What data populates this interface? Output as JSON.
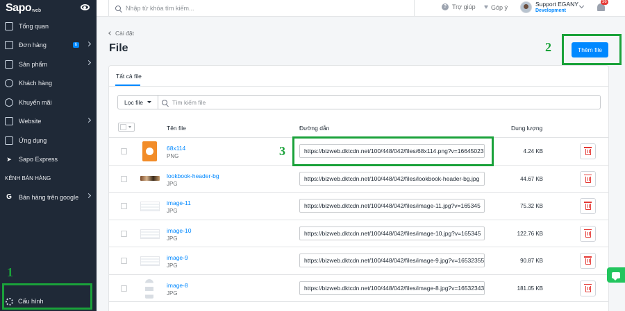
{
  "brand": {
    "name": "Sapo",
    "suffix": "web"
  },
  "sidebar": {
    "items": [
      {
        "label": "Tổng quan"
      },
      {
        "label": "Đơn hàng",
        "badge": "6"
      },
      {
        "label": "Sản phẩm"
      },
      {
        "label": "Khách hàng"
      },
      {
        "label": "Khuyến mãi"
      },
      {
        "label": "Website"
      },
      {
        "label": "Ứng dụng"
      },
      {
        "label": "Sapo Express"
      }
    ],
    "section_label": "KÊNH BÁN HÀNG",
    "channel_item": {
      "label": "Bán hàng trên google"
    },
    "settings_label": "Cấu hình"
  },
  "topbar": {
    "search_placeholder": "Nhập từ khóa tìm kiếm...",
    "help_label": "Trợ giúp",
    "feedback_label": "Góp ý",
    "user_name": "Support EGANY",
    "user_role": "Development",
    "notification_count": "36"
  },
  "page": {
    "breadcrumb": "Cài đặt",
    "title": "File",
    "add_button": "Thêm file"
  },
  "tabs": [
    {
      "label": "Tất cả file"
    }
  ],
  "filter": {
    "filter_label": "Lọc file",
    "search_placeholder": "Tìm kiếm file"
  },
  "table": {
    "columns": {
      "name": "Tên file",
      "url": "Đường dẫn",
      "size": "Dung lượng"
    },
    "rows": [
      {
        "name": "68x114",
        "type": "PNG",
        "url": "https://bizweb.dktcdn.net/100/448/042/files/68x114.png?v=16645023",
        "size": "4.24 KB",
        "thumb": "png"
      },
      {
        "name": "lookbook-header-bg",
        "type": "JPG",
        "url": "https://bizweb.dktcdn.net/100/448/042/files/lookbook-header-bg.jpg",
        "size": "44.67 KB",
        "thumb": "banner"
      },
      {
        "name": "image-11",
        "type": "JPG",
        "url": "https://bizweb.dktcdn.net/100/448/042/files/image-11.jpg?v=165345",
        "size": "75.32 KB",
        "thumb": "sheet"
      },
      {
        "name": "image-10",
        "type": "JPG",
        "url": "https://bizweb.dktcdn.net/100/448/042/files/image-10.jpg?v=165345",
        "size": "122.76 KB",
        "thumb": "sheet"
      },
      {
        "name": "image-9",
        "type": "JPG",
        "url": "https://bizweb.dktcdn.net/100/448/042/files/image-9.jpg?v=16532355",
        "size": "90.87 KB",
        "thumb": "sheet"
      },
      {
        "name": "image-8",
        "type": "JPG",
        "url": "https://bizweb.dktcdn.net/100/448/042/files/image-8.jpg?v=16532343",
        "size": "181.05 KB",
        "thumb": "fig"
      }
    ]
  },
  "annotations": {
    "settings_marker": "1",
    "add_button_marker": "2",
    "url_marker": "3",
    "color": "#1aa23a"
  },
  "colors": {
    "accent": "#0088ff",
    "sidebar": "#1f2937",
    "danger": "#e53935"
  }
}
